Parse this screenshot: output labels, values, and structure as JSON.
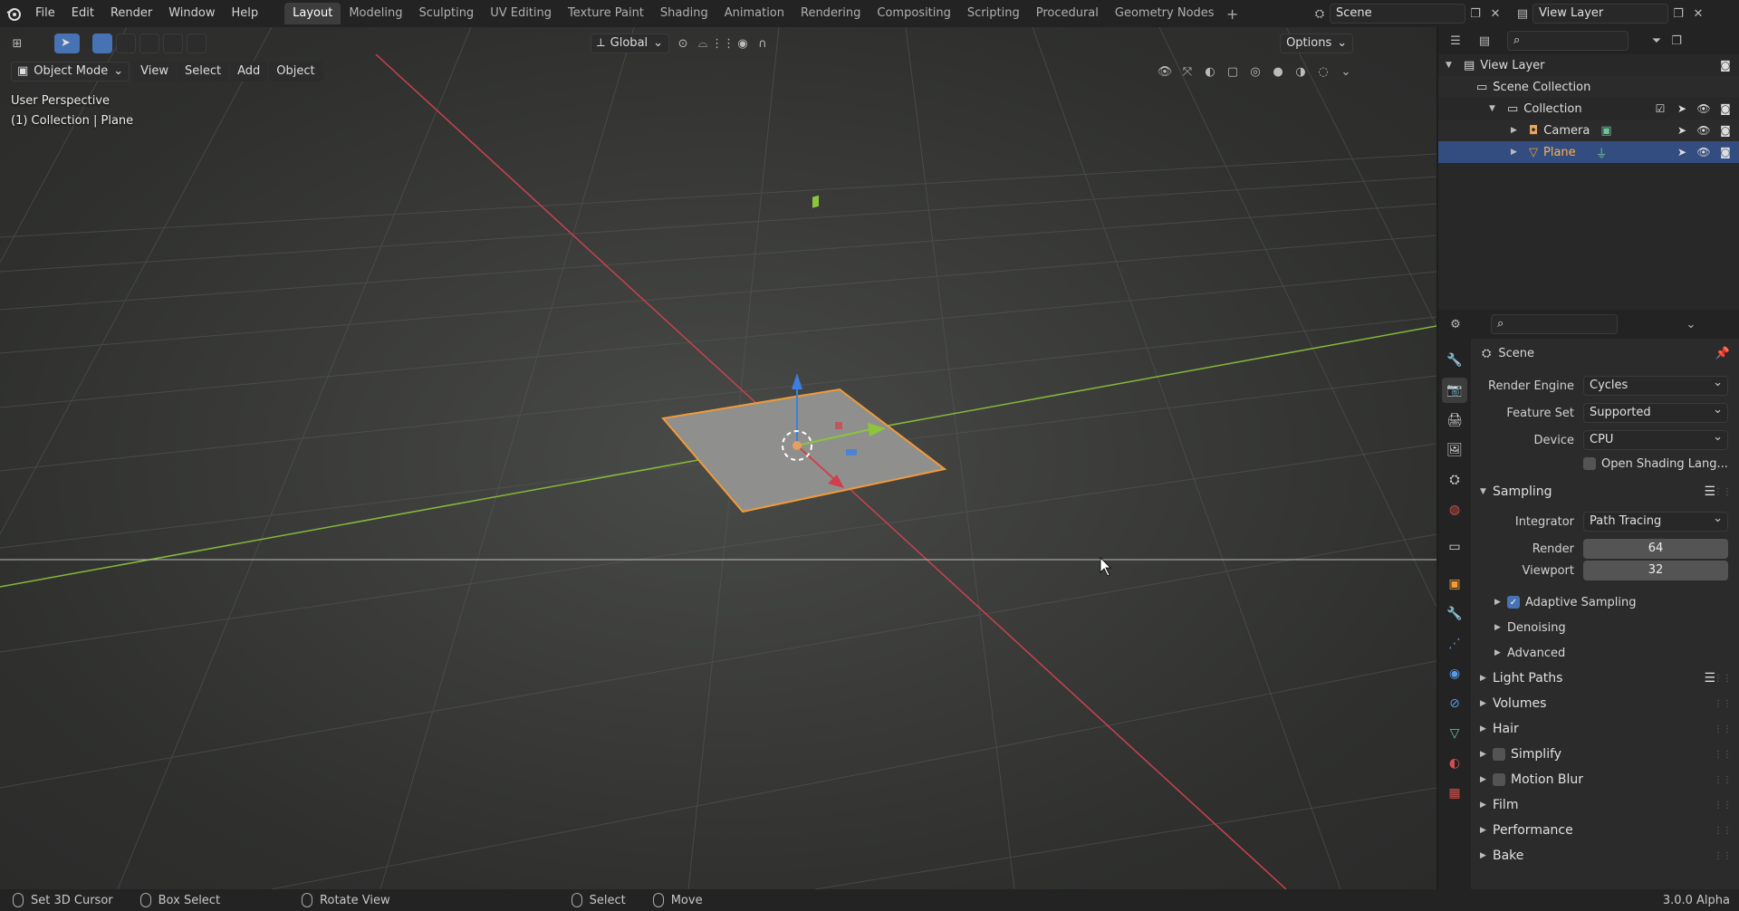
{
  "menu": [
    "File",
    "Edit",
    "Render",
    "Window",
    "Help"
  ],
  "workspaces": [
    "Layout",
    "Modeling",
    "Sculpting",
    "UV Editing",
    "Texture Paint",
    "Shading",
    "Animation",
    "Rendering",
    "Compositing",
    "Scripting",
    "Procedural",
    "Geometry Nodes"
  ],
  "active_workspace": "Layout",
  "scene_name": "Scene",
  "view_layer_name": "View Layer",
  "viewport": {
    "mode": "Object Mode",
    "menus": [
      "View",
      "Select",
      "Add",
      "Object"
    ],
    "transform_orientation": "Global",
    "options_label": "Options",
    "perspective_label": "User Perspective",
    "context_label": "(1) Collection | Plane"
  },
  "outliner": {
    "rows": [
      {
        "label": "View Layer"
      },
      {
        "label": "Scene Collection"
      },
      {
        "label": "Collection"
      },
      {
        "label": "Camera"
      },
      {
        "label": "Plane"
      }
    ]
  },
  "properties": {
    "context_title": "Scene",
    "render_engine_label": "Render Engine",
    "render_engine": "Cycles",
    "feature_set_label": "Feature Set",
    "feature_set": "Supported",
    "device_label": "Device",
    "device": "CPU",
    "osl_label": "Open Shading Lang...",
    "sampling": "Sampling",
    "integrator_label": "Integrator",
    "integrator": "Path Tracing",
    "render_label": "Render",
    "render_samples": "64",
    "viewport_label": "Viewport",
    "viewport_samples": "32",
    "adaptive_sampling": "Adaptive Sampling",
    "denoising": "Denoising",
    "advanced": "Advanced",
    "panels": [
      "Light Paths",
      "Volumes",
      "Hair",
      "Simplify",
      "Motion Blur",
      "Film",
      "Performance",
      "Bake"
    ]
  },
  "statusbar": {
    "items": [
      "Set 3D Cursor",
      "Box Select",
      "Rotate View",
      "Select",
      "Move"
    ],
    "version": "3.0.0 Alpha"
  },
  "colors": {
    "accent": "#4772b3",
    "selection_orange": "#f29a38",
    "x_axis": "#d0404c",
    "y_axis": "#8cc43c",
    "z_axis": "#3d7fe0"
  }
}
